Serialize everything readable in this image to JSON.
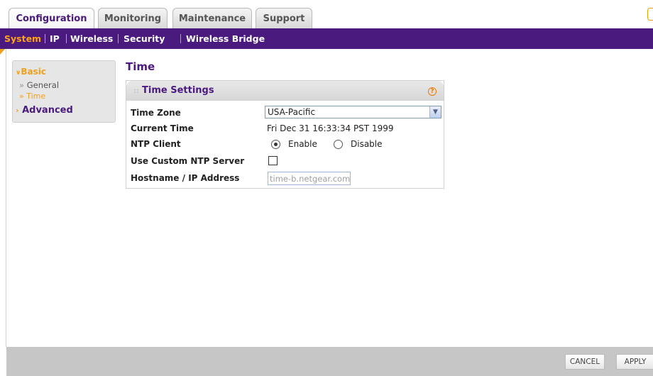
{
  "top_tabs": [
    {
      "label": "Configuration",
      "active": true
    },
    {
      "label": "Monitoring",
      "active": false
    },
    {
      "label": "Maintenance",
      "active": false
    },
    {
      "label": "Support",
      "active": false
    }
  ],
  "sub_nav": [
    {
      "label": "System",
      "active": true
    },
    {
      "label": "IP",
      "active": false
    },
    {
      "label": "Wireless",
      "active": false
    },
    {
      "label": "Security",
      "active": false
    },
    {
      "label": "Wireless Bridge",
      "active": false
    }
  ],
  "left_menu": {
    "basic": "Basic",
    "general": "General",
    "time": "Time",
    "advanced": "Advanced"
  },
  "page": {
    "title": "Time",
    "panel_title": "Time Settings",
    "help_glyph": "?"
  },
  "form": {
    "time_zone_label": "Time Zone",
    "time_zone_value": "USA-Pacific",
    "current_time_label": "Current Time",
    "current_time_value": "Fri Dec 31 16:33:34 PST 1999",
    "ntp_client_label": "NTP Client",
    "ntp_enable": "Enable",
    "ntp_disable": "Disable",
    "ntp_selected": "Enable",
    "custom_ntp_label": "Use Custom NTP Server",
    "custom_ntp_checked": false,
    "hostname_label": "Hostname / IP Address",
    "hostname_value": "time-b.netgear.com"
  },
  "buttons": {
    "cancel": "CANCEL",
    "apply": "APPLY"
  },
  "colors": {
    "brand_purple": "#4b1a7e",
    "accent_orange": "#f0a020"
  }
}
